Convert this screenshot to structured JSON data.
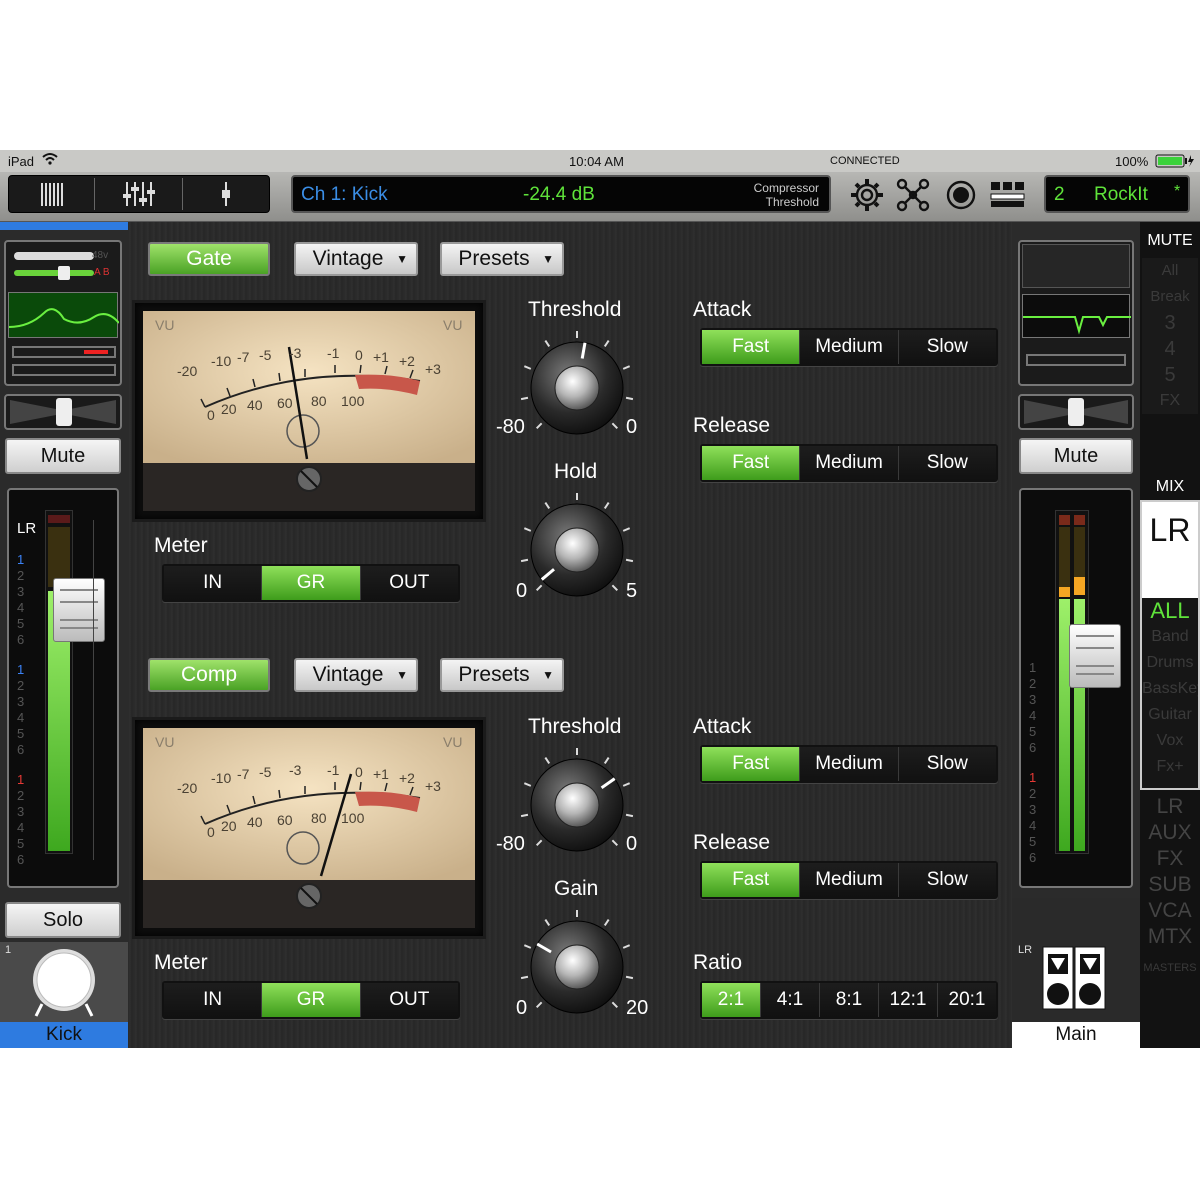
{
  "status": {
    "device": "iPad",
    "time": "10:04 AM",
    "connection": "CONNECTED",
    "battery": "100%"
  },
  "toolbar": {
    "channel": "Ch 1: Kick",
    "value": "-24.4 dB",
    "param_line1": "Compressor",
    "param_line2": "Threshold",
    "snapshot_num": "2",
    "snapshot_name": "RockIt",
    "snapshot_mod": "*",
    "icons": [
      "gear-icon",
      "routing-icon",
      "record-icon",
      "screens-icon"
    ]
  },
  "gate": {
    "enable": "Gate",
    "model": "Vintage",
    "presets": "Presets",
    "vu_left": "VU",
    "vu_right": "VU",
    "scale_top": [
      "-20",
      "-10",
      "-7",
      "-5",
      "-3",
      "-1",
      "0",
      "+1",
      "+2",
      "+3"
    ],
    "scale_bottom": [
      "0",
      "20",
      "40",
      "60",
      "80",
      "100"
    ],
    "meter_label": "Meter",
    "meter_opts": [
      "IN",
      "GR",
      "OUT"
    ],
    "meter_sel": 1,
    "threshold": {
      "label": "Threshold",
      "min": "-80",
      "max": "0"
    },
    "hold": {
      "label": "Hold",
      "min": "0",
      "max": "5"
    },
    "attack": {
      "label": "Attack",
      "opts": [
        "Fast",
        "Medium",
        "Slow"
      ],
      "sel": 0
    },
    "release": {
      "label": "Release",
      "opts": [
        "Fast",
        "Medium",
        "Slow"
      ],
      "sel": 0
    }
  },
  "comp": {
    "enable": "Comp",
    "model": "Vintage",
    "presets": "Presets",
    "vu_left": "VU",
    "vu_right": "VU",
    "meter_label": "Meter",
    "meter_opts": [
      "IN",
      "GR",
      "OUT"
    ],
    "meter_sel": 1,
    "threshold": {
      "label": "Threshold",
      "min": "-80",
      "max": "0"
    },
    "gain": {
      "label": "Gain",
      "min": "0",
      "max": "20"
    },
    "attack": {
      "label": "Attack",
      "opts": [
        "Fast",
        "Medium",
        "Slow"
      ],
      "sel": 0
    },
    "release": {
      "label": "Release",
      "opts": [
        "Fast",
        "Medium",
        "Slow"
      ],
      "sel": 0
    },
    "ratio": {
      "label": "Ratio",
      "opts": [
        "2:1",
        "4:1",
        "8:1",
        "12:1",
        "20:1"
      ],
      "sel": 0
    }
  },
  "left_strip": {
    "phantom": "48v",
    "ab": "A B",
    "mute": "Mute",
    "bus": "LR",
    "groups": [
      "1",
      "2",
      "3",
      "4",
      "5",
      "6"
    ],
    "solo": "Solo",
    "num": "1",
    "name": "Kick"
  },
  "right_strip": {
    "mute": "Mute",
    "bus": "LR",
    "name": "Main"
  },
  "right_nav": {
    "mute_title": "MUTE",
    "mute_items": [
      "All",
      "Break",
      "3",
      "4",
      "5",
      "FX"
    ],
    "mix_title": "MIX",
    "mix_current": "LR",
    "view_items": [
      "ALL",
      "Band",
      "Drums",
      "BassKeys",
      "Guitar",
      "Vox",
      "Fx+"
    ],
    "bus_items": [
      "LR",
      "AUX",
      "FX",
      "SUB",
      "VCA",
      "MTX"
    ],
    "masters": "MASTERS"
  }
}
